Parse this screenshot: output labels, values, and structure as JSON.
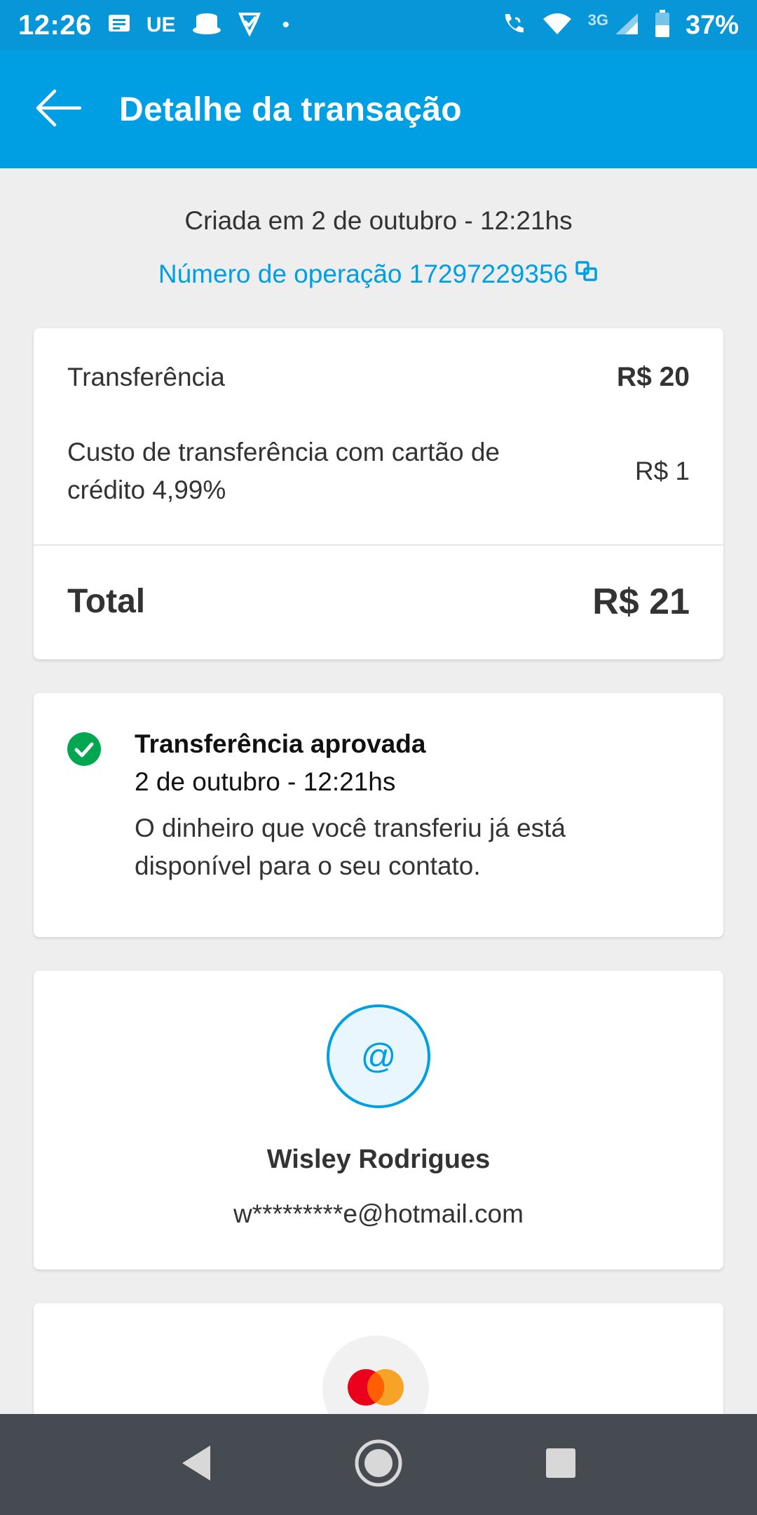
{
  "status_bar": {
    "time": "12:26",
    "app_text": "UE",
    "network": "3G",
    "battery": "37%"
  },
  "header": {
    "title": "Detalhe da transação"
  },
  "transaction": {
    "created": "Criada em 2 de outubro - 12:21hs",
    "operation": "Número de operação 17297229356"
  },
  "summary": {
    "transfer_label": "Transferência",
    "transfer_value": "R$ 20",
    "fee_label": "Custo de transferência com cartão de crédito 4,99%",
    "fee_value": "R$ 1",
    "total_label": "Total",
    "total_value": "R$ 21"
  },
  "status": {
    "title": "Transferência aprovada",
    "date": "2 de outubro - 12:21hs",
    "description": "O dinheiro que você transferiu já está disponível para o seu contato."
  },
  "contact": {
    "avatar_symbol": "@",
    "name": "Wisley Rodrigues",
    "email": "w*********e@hotmail.com"
  },
  "colors": {
    "primary": "#009ee3",
    "status_bar": "#0796d8",
    "success": "#00a650",
    "background": "#eeeeee",
    "nav_bar": "#454b50"
  },
  "icons": {
    "back": "arrow-left-icon",
    "copy": "copy-icon",
    "check": "check-circle-icon",
    "card": "mastercard-icon"
  }
}
